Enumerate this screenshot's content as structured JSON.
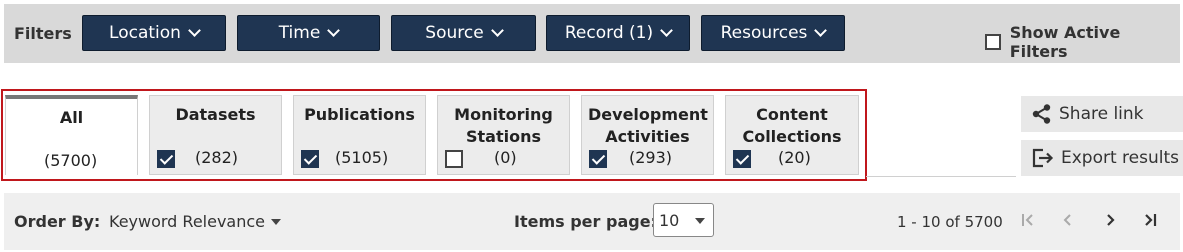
{
  "filters": {
    "label": "Filters",
    "buttons": [
      {
        "name": "location",
        "label": "Location"
      },
      {
        "name": "time",
        "label": "Time"
      },
      {
        "name": "source",
        "label": "Source"
      },
      {
        "name": "record",
        "label": "Record (1)"
      },
      {
        "name": "resources",
        "label": "Resources"
      }
    ],
    "show_active": {
      "label": "Show Active Filters",
      "checked": false
    }
  },
  "tabs": [
    {
      "title": "All",
      "count": "(5700)",
      "active": true
    },
    {
      "title": "Datasets",
      "count": "(282)",
      "checked": true
    },
    {
      "title": "Publications",
      "count": "(5105)",
      "checked": true
    },
    {
      "title": "Monitoring Stations",
      "count": "(0)",
      "checked": false
    },
    {
      "title": "Development Activities",
      "count": "(293)",
      "checked": true
    },
    {
      "title": "Content Collections",
      "count": "(20)",
      "checked": true
    }
  ],
  "actions": {
    "share_label": "Share link",
    "export_label": "Export results"
  },
  "bottom": {
    "order_label": "Order By:",
    "order_value": "Keyword Relevance",
    "ipp_label": "Items per page:",
    "ipp_value": "10",
    "range": "1 - 10 of 5700"
  },
  "colors": {
    "button_bg": "#1f3552",
    "highlight_border": "#c0171c"
  },
  "icons": [
    "chevron-down-icon",
    "share-icon",
    "export-icon",
    "first-page-icon",
    "prev-page-icon",
    "next-page-icon",
    "last-page-icon"
  ]
}
